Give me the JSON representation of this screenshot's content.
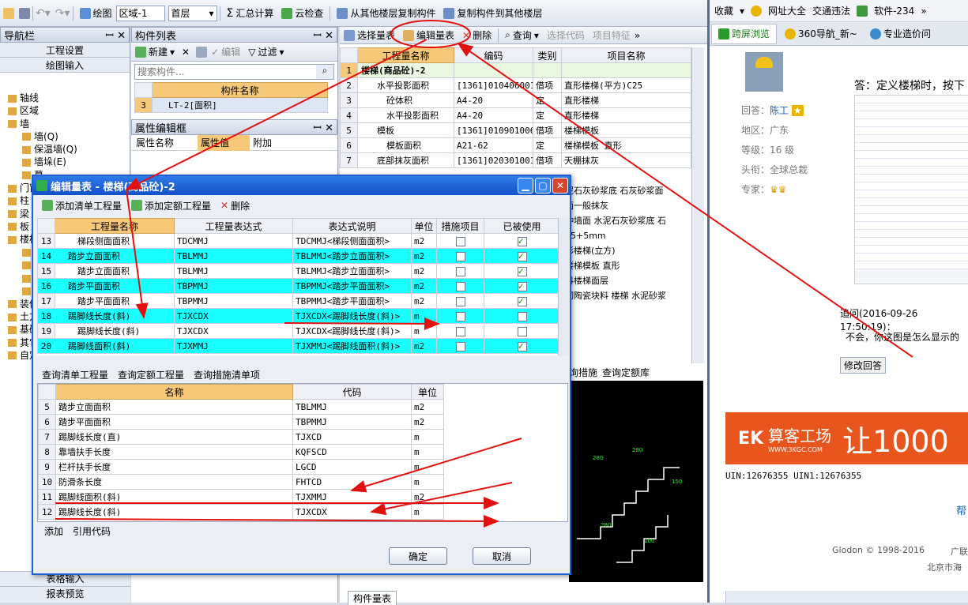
{
  "toolbar": {
    "draw": "绘图",
    "area": "区域-1",
    "floor": "首层",
    "sum": "汇总计算",
    "cloud": "云检查",
    "copy_from": "从其他楼层复制构件",
    "copy_to": "复制构件到其他楼层"
  },
  "nav": {
    "title": "导航栏",
    "btn1": "工程设置",
    "btn2": "绘图输入",
    "items": [
      "轴线",
      "区域",
      "墙",
      "墙(Q)",
      "保温墙(Q)",
      "墙垛(E)",
      "幕",
      "门窗",
      "柱",
      "梁",
      "板",
      "楼梯",
      "楼",
      "直",
      "螺",
      "楼",
      "装修",
      "土方",
      "基础",
      "其它",
      "自定"
    ],
    "bottom1": "表格输入",
    "bottom2": "报表预览"
  },
  "comp": {
    "title": "构件列表",
    "new": "新建",
    "edit": "编辑",
    "filter": "过滤",
    "search_placeholder": "搜索构件...",
    "col": "构件名称",
    "row_num": "3",
    "row_name": "LT-2[面积]"
  },
  "prop": {
    "title": "属性编辑框",
    "c1": "属性名称",
    "c2": "属性值",
    "c3": "附加"
  },
  "qty": {
    "select": "选择量表",
    "edit": "编辑量表",
    "delete": "删除",
    "query": "查询",
    "select_code": "选择代码",
    "feature": "项目特征",
    "cols": [
      "工程量名称",
      "编码",
      "类别",
      "项目名称"
    ],
    "rows": [
      [
        "1",
        "楼梯(商品砼)-2",
        "",
        "",
        ""
      ],
      [
        "2",
        "水平投影面积",
        "[1361]010406001",
        "借项",
        "直形楼梯(平方)C25"
      ],
      [
        "3",
        "砼体积",
        "A4-20",
        "定",
        "直形楼梯"
      ],
      [
        "4",
        "水平投影面积",
        "A4-20",
        "定",
        "直形楼梯"
      ],
      [
        "5",
        "模板",
        "[1361]010901006",
        "借项",
        "楼梯模板"
      ],
      [
        "6",
        "模板面积",
        "A21-62",
        "定",
        "楼梯模板 直形"
      ],
      [
        "7",
        "底部抹灰面积",
        "[1361]020301001",
        "借项",
        "天棚抹灰"
      ]
    ],
    "right_texts": [
      "泥石灰砂浆底 石灰砂浆面",
      "面一般抹灰",
      "种墙面 水泥石灰砂浆底 石",
      "15+5mm",
      "形楼梯(立方)",
      "楼梯模板 直形",
      "料楼梯面层",
      "砌陶瓷块料 楼梯 水泥砂浆"
    ],
    "tab1": "询措施",
    "tab2": "查询定额库",
    "bottom_tab": "构件量表"
  },
  "dialog": {
    "title": "编辑量表 - 楼梯(商品砼)-2",
    "add_list": "添加清单工程量",
    "add_quota": "添加定额工程量",
    "delete": "删除",
    "cols": [
      "工程量名称",
      "工程量表达式",
      "表达式说明",
      "单位",
      "措施项目",
      "已被使用"
    ],
    "rows": [
      {
        "n": "13",
        "name": "梯段侧面面积",
        "expr": "TDCMMJ",
        "desc": "TDCMMJ<梯段侧面面积>",
        "unit": "m2",
        "measure": false,
        "used": true,
        "hl": false,
        "grp": false
      },
      {
        "n": "14",
        "name": "踏步立面面积",
        "expr": "TBLMMJ",
        "desc": "TBLMMJ<踏步立面面积>",
        "unit": "m2",
        "measure": false,
        "used": true,
        "hl": true,
        "grp": true
      },
      {
        "n": "15",
        "name": "踏步立面面积",
        "expr": "TBLMMJ",
        "desc": "TBLMMJ<踏步立面面积>",
        "unit": "m2",
        "measure": false,
        "used": true,
        "hl": false,
        "grp": false
      },
      {
        "n": "16",
        "name": "踏步平面面积",
        "expr": "TBPMMJ",
        "desc": "TBPMMJ<踏步平面面积>",
        "unit": "m2",
        "measure": false,
        "used": true,
        "hl": true,
        "grp": true
      },
      {
        "n": "17",
        "name": "踏步平面面积",
        "expr": "TBPMMJ",
        "desc": "TBPMMJ<踏步平面面积>",
        "unit": "m2",
        "measure": false,
        "used": true,
        "hl": false,
        "grp": false
      },
      {
        "n": "18",
        "name": "踢脚线长度(斜)",
        "expr": "TJXCDX",
        "desc": "TJXCDX<踢脚线长度(斜)>",
        "unit": "m",
        "measure": false,
        "used": false,
        "hl": true,
        "grp": true
      },
      {
        "n": "19",
        "name": "踢脚线长度(斜)",
        "expr": "TJXCDX",
        "desc": "TJXCDX<踢脚线长度(斜)>",
        "unit": "m",
        "measure": false,
        "used": false,
        "hl": false,
        "grp": false
      },
      {
        "n": "20",
        "name": "踢脚线面积(斜)",
        "expr": "TJXMMJ",
        "desc": "TJXMMJ<踢脚线面积(斜)>",
        "unit": "m2",
        "measure": false,
        "used": true,
        "hl": true,
        "grp": true
      }
    ],
    "tabs": [
      "查询清单工程量",
      "查询定额工程量",
      "查询措施清单项"
    ],
    "qcols": [
      "名称",
      "代码",
      "单位"
    ],
    "qrows": [
      [
        "5",
        "踏步立面面积",
        "TBLMMJ",
        "m2"
      ],
      [
        "6",
        "踏步平面面积",
        "TBPMMJ",
        "m2"
      ],
      [
        "7",
        "踢脚线长度(直)",
        "TJXCD",
        "m"
      ],
      [
        "8",
        "靠墙扶手长度",
        "KQFSCD",
        "m"
      ],
      [
        "9",
        "栏杆扶手长度",
        "LGCD",
        "m"
      ],
      [
        "10",
        "防滑条长度",
        "FHTCD",
        "m"
      ],
      [
        "11",
        "踢脚线面积(斜)",
        "TJXMMJ",
        "m2"
      ],
      [
        "12",
        "踢脚线长度(斜)",
        "TJXCDX",
        "m"
      ]
    ],
    "add": "添加",
    "ref": "引用代码",
    "ok": "确定",
    "cancel": "取消"
  },
  "browser": {
    "fav": "收藏",
    "site1": "网址大全",
    "site2": "交通违法",
    "site3": "软件-234",
    "tab1": "跨屏浏览",
    "tab2": "360导航_新~",
    "tab3": "专业造价问",
    "answer": "答：定义楼梯时，按下",
    "resp_label": "回答：",
    "resp_name": "陈工",
    "region": "地区：广东",
    "level": "等级：16 级",
    "honor": "头衔：全球总栽",
    "expert": "专家：",
    "followup": "追问(2016-09-26 17:50:19)：",
    "question": "不会，你这图是怎么显示的",
    "modify": "修改回答",
    "banner1": "算客工场",
    "banner_url": "WWW.3KGC.COM",
    "banner2": "让1000",
    "uin": "UIN:12676355 UIN1:12676355",
    "help": "帮",
    "copy": "Glodon © 1998-2016",
    "corp": "广联",
    "addr": "北京市海"
  }
}
